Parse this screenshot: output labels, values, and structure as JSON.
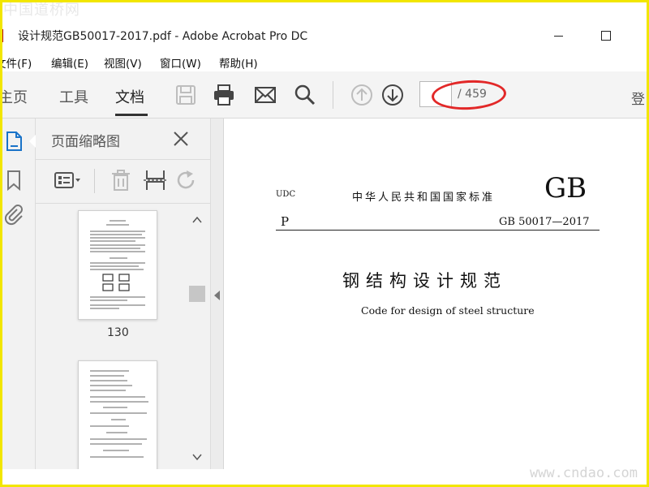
{
  "watermark": {
    "top": "中国道桥网",
    "bottom": "www.cndao.com"
  },
  "window": {
    "title": "设计规范GB50017-2017.pdf - Adobe Acrobat Pro DC"
  },
  "menu": {
    "items": [
      "文件(F)",
      "编辑(E)",
      "视图(V)",
      "窗口(W)",
      "帮助(H)"
    ]
  },
  "toolbar": {
    "tabs": [
      "主页",
      "工具",
      "文档"
    ],
    "active_tab": "文档",
    "icons": [
      "save-icon",
      "print-icon",
      "email-icon",
      "search-icon",
      "arrow-up-icon",
      "arrow-down-icon"
    ],
    "page_input_value": "",
    "page_total": "/ 459",
    "login_label": "登"
  },
  "panel": {
    "title": "页面缩略图",
    "tools": [
      "thumbnail-options-icon",
      "delete-icon",
      "crop-icon",
      "rotate-icon"
    ],
    "thumbnails": [
      {
        "label": "130"
      },
      {
        "label": ""
      }
    ]
  },
  "document": {
    "udc": "UDC",
    "standard_cn": "中华人民共和国国家标准",
    "logo": "GB",
    "p_letter": "P",
    "standard_no": "GB 50017—2017",
    "title": "钢结构设计规范",
    "subtitle": "Code for design of steel structure"
  },
  "colors": {
    "frame": "#f2e600",
    "annotation": "#e22828",
    "acrobat_red": "#b30b00"
  }
}
